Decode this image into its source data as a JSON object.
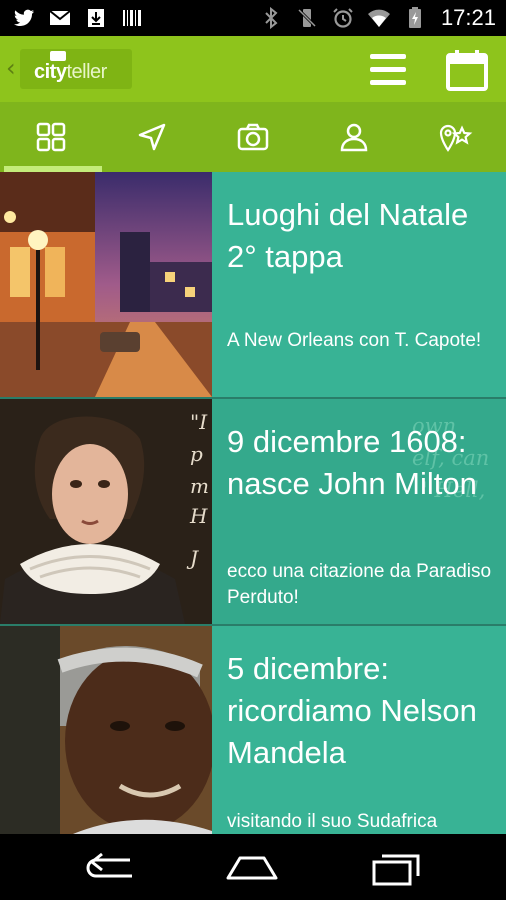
{
  "status_bar": {
    "time": "17:21",
    "icons": [
      "twitter-icon",
      "mail-icon",
      "download-icon",
      "barcode-icon",
      "bluetooth-icon",
      "vibrate-icon",
      "alarm-icon",
      "wifi-icon",
      "battery-icon"
    ]
  },
  "action_bar": {
    "logo_city": "city",
    "logo_teller": "teller",
    "icons": [
      "back-chevron-icon",
      "menu-icon",
      "calendar-icon"
    ]
  },
  "tabs": [
    {
      "icon": "grid-icon",
      "selected": true
    },
    {
      "icon": "navigation-arrow-icon",
      "selected": false
    },
    {
      "icon": "camera-icon",
      "selected": false
    },
    {
      "icon": "user-icon",
      "selected": false
    },
    {
      "icon": "place-star-icon",
      "selected": false
    }
  ],
  "colors": {
    "action_bar": "#8ec41c",
    "tab_bar": "#7fb51c",
    "tab_indicator": "#c4ec7a",
    "card_panel": "#38b496"
  },
  "feed": [
    {
      "title": "Luoghi del Natale 2° tappa",
      "subtitle": "A New Orleans con T. Capote!",
      "image": "new-orleans-night-street"
    },
    {
      "title": "9 dicembre 1608: nasce John Milton",
      "subtitle": "ecco una citazione da Paradiso Perduto!",
      "image": "john-milton-portrait",
      "quote_line_1": "own",
      "quote_line_2": "elf, can",
      "quote_line_3": "' Hell,",
      "quote_signature": "J"
    },
    {
      "title": "5 dicembre: ricordiamo Nelson Mandela",
      "subtitle": "visitando il suo Sudafrica",
      "image": "nelson-mandela-portrait"
    }
  ],
  "nav_bar": {
    "icons": [
      "back-icon",
      "home-icon",
      "recent-apps-icon"
    ]
  }
}
